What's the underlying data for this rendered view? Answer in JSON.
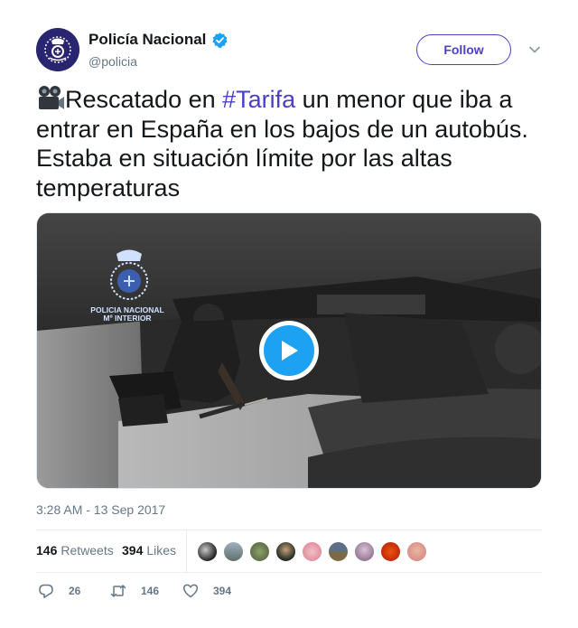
{
  "author": {
    "name": "Policía Nacional",
    "handle": "@policia",
    "avatar_icon": "police-crest-icon",
    "verified_icon": "verified-badge-icon"
  },
  "follow_button": {
    "label": "Follow"
  },
  "tweet": {
    "text_before": "Rescatado en ",
    "hashtag": "#Tarifa",
    "text_after": " un menor que iba a entrar en España en los bajos de un autobús. Estaba en situación límite por las altas temperaturas",
    "emoji_icon": "movie-camera-icon"
  },
  "media": {
    "type": "video",
    "watermark_line1": "POLICIA NACIONAL",
    "watermark_line2": "Mº INTERIOR",
    "play_icon": "play-icon"
  },
  "timestamp": "3:28 AM - 13 Sep 2017",
  "stats": {
    "retweets_count": "146",
    "retweets_label": "Retweets",
    "likes_count": "394",
    "likes_label": "Likes"
  },
  "actions": {
    "reply_count": "26",
    "retweet_count": "146",
    "like_count": "394"
  },
  "colors": {
    "accent": "#4a3fc9",
    "verified": "#1da1f2",
    "muted": "#657786"
  }
}
